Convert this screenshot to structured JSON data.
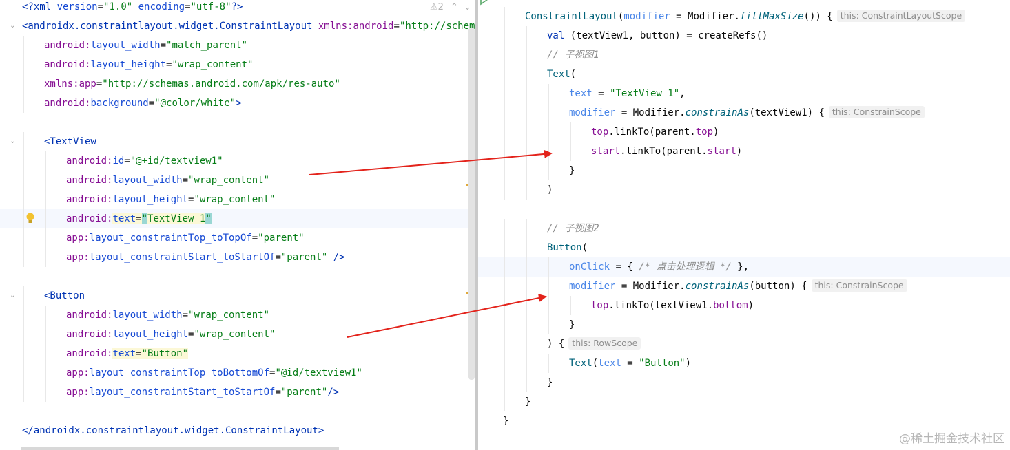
{
  "left": {
    "warning_count": "2",
    "lines": [
      {
        "y": 0,
        "indent": 0,
        "fold": false,
        "tokens": [
          [
            "tk-xml",
            "<?xml "
          ],
          [
            "tk-attr",
            "version"
          ],
          [
            "tk-plain",
            "="
          ],
          [
            "tk-val",
            "\"1.0\""
          ],
          [
            "tk-plain",
            " "
          ],
          [
            "tk-attr",
            "encoding"
          ],
          [
            "tk-plain",
            "="
          ],
          [
            "tk-val",
            "\"utf-8\""
          ],
          [
            "tk-xml",
            "?>"
          ]
        ]
      },
      {
        "indent": 0,
        "fold": true,
        "tokens": [
          [
            "tk-tag",
            "<androidx.constraintlayout.widget.ConstraintLayout "
          ],
          [
            "tk-ns",
            "xmlns:android"
          ],
          [
            "tk-plain",
            "="
          ],
          [
            "tk-val",
            "\"http://schemas.android.com/apk/res/android\""
          ]
        ]
      },
      {
        "indent": 1,
        "tokens": [
          [
            "tk-ns",
            "android:"
          ],
          [
            "tk-attr",
            "layout_width"
          ],
          [
            "tk-plain",
            "="
          ],
          [
            "tk-val",
            "\"match_parent\""
          ]
        ]
      },
      {
        "indent": 1,
        "tokens": [
          [
            "tk-ns",
            "android:"
          ],
          [
            "tk-attr",
            "layout_height"
          ],
          [
            "tk-plain",
            "="
          ],
          [
            "tk-val",
            "\"wrap_content\""
          ]
        ]
      },
      {
        "indent": 1,
        "tokens": [
          [
            "tk-ns",
            "xmlns:app"
          ],
          [
            "tk-plain",
            "="
          ],
          [
            "tk-val",
            "\"http://schemas.android.com/apk/res-auto\""
          ]
        ]
      },
      {
        "indent": 1,
        "tokens": [
          [
            "tk-ns",
            "android:"
          ],
          [
            "tk-attr",
            "background"
          ],
          [
            "tk-plain",
            "="
          ],
          [
            "tk-val",
            "\"@color/white\""
          ],
          [
            "tk-tag",
            ">"
          ]
        ]
      },
      {
        "indent": 0,
        "tokens": []
      },
      {
        "indent": 1,
        "fold": true,
        "tokens": [
          [
            "tk-tag",
            "<TextView"
          ]
        ]
      },
      {
        "indent": 2,
        "tokens": [
          [
            "tk-ns",
            "android:"
          ],
          [
            "tk-attr",
            "id"
          ],
          [
            "tk-plain",
            "="
          ],
          [
            "tk-val",
            "\"@+id/textview1\""
          ]
        ]
      },
      {
        "indent": 2,
        "tokens": [
          [
            "tk-ns",
            "android:"
          ],
          [
            "tk-attr",
            "layout_width"
          ],
          [
            "tk-plain",
            "="
          ],
          [
            "tk-val",
            "\"wrap_content\""
          ]
        ]
      },
      {
        "indent": 2,
        "tokens": [
          [
            "tk-ns",
            "android:"
          ],
          [
            "tk-attr",
            "layout_height"
          ],
          [
            "tk-plain",
            "="
          ],
          [
            "tk-val",
            "\"wrap_content\""
          ]
        ]
      },
      {
        "indent": 2,
        "hl": true,
        "bulb": true,
        "mark": true,
        "tokens": [
          [
            "tk-ns",
            "android:"
          ],
          [
            "tk-attr",
            "text"
          ],
          [
            "tk-plain",
            "="
          ],
          [
            "tk-val cursor-bg",
            "\""
          ],
          [
            "tk-val",
            "TextView 1"
          ],
          [
            "tk-val cursor-bg",
            "\""
          ]
        ]
      },
      {
        "indent": 2,
        "tokens": [
          [
            "tk-ns",
            "app:"
          ],
          [
            "tk-attr",
            "layout_constraintTop_toTopOf"
          ],
          [
            "tk-plain",
            "="
          ],
          [
            "tk-val",
            "\"parent\""
          ]
        ]
      },
      {
        "indent": 2,
        "tokens": [
          [
            "tk-ns",
            "app:"
          ],
          [
            "tk-attr",
            "layout_constraintStart_toStartOf"
          ],
          [
            "tk-plain",
            "="
          ],
          [
            "tk-val",
            "\"parent\""
          ],
          [
            "tk-tag",
            " />"
          ]
        ]
      },
      {
        "indent": 0,
        "tokens": []
      },
      {
        "indent": 1,
        "fold": true,
        "tokens": [
          [
            "tk-tag",
            "<Button"
          ]
        ]
      },
      {
        "indent": 2,
        "tokens": [
          [
            "tk-ns",
            "android:"
          ],
          [
            "tk-attr",
            "layout_width"
          ],
          [
            "tk-plain",
            "="
          ],
          [
            "tk-val",
            "\"wrap_content\""
          ]
        ]
      },
      {
        "indent": 2,
        "tokens": [
          [
            "tk-ns",
            "android:"
          ],
          [
            "tk-attr",
            "layout_height"
          ],
          [
            "tk-plain",
            "="
          ],
          [
            "tk-val",
            "\"wrap_content\""
          ]
        ]
      },
      {
        "indent": 2,
        "mark": true,
        "tokens": [
          [
            "tk-ns",
            "android:"
          ],
          [
            "tk-attr",
            "text"
          ],
          [
            "tk-plain",
            "="
          ],
          [
            "tk-val",
            "\"Button\""
          ]
        ]
      },
      {
        "indent": 2,
        "tokens": [
          [
            "tk-ns",
            "app:"
          ],
          [
            "tk-attr",
            "layout_constraintTop_toBottomOf"
          ],
          [
            "tk-plain",
            "="
          ],
          [
            "tk-val",
            "\"@id/textview1\""
          ]
        ]
      },
      {
        "indent": 2,
        "tokens": [
          [
            "tk-ns",
            "app:"
          ],
          [
            "tk-attr",
            "layout_constraintStart_toStartOf"
          ],
          [
            "tk-plain",
            "="
          ],
          [
            "tk-val",
            "\"parent\""
          ],
          [
            "tk-tag",
            "/>"
          ]
        ]
      },
      {
        "indent": 0,
        "tokens": []
      },
      {
        "indent": 0,
        "tokens": [
          [
            "tk-tag",
            "</androidx.constraintlayout.widget.ConstraintLayout>"
          ]
        ]
      }
    ]
  },
  "right": {
    "lines": [
      {
        "indent": 1,
        "tokens": [
          [
            "tk-fn",
            "ConstraintLayout"
          ],
          [
            "tk-plain",
            "("
          ],
          [
            "tk-param",
            "modifier"
          ],
          [
            "tk-plain",
            " = "
          ],
          [
            "tk-plain",
            "Modifier."
          ],
          [
            "tk-ital",
            "fillMaxSize"
          ],
          [
            "tk-plain",
            "()) {"
          ]
        ],
        "hint": "this: ConstraintLayoutScope"
      },
      {
        "indent": 2,
        "tokens": [
          [
            "tk-kw",
            "val "
          ],
          [
            "tk-plain",
            "(textView1, button) = createRefs()"
          ]
        ]
      },
      {
        "indent": 2,
        "tokens": [
          [
            "tk-comment",
            "// 子视图1"
          ]
        ]
      },
      {
        "indent": 2,
        "tokens": [
          [
            "tk-fn",
            "Text"
          ],
          [
            "tk-plain",
            "("
          ]
        ]
      },
      {
        "indent": 3,
        "tokens": [
          [
            "tk-param",
            "text"
          ],
          [
            "tk-plain",
            " = "
          ],
          [
            "tk-str",
            "\"TextView 1\""
          ],
          [
            "tk-plain",
            ","
          ]
        ]
      },
      {
        "indent": 3,
        "tokens": [
          [
            "tk-param",
            "modifier"
          ],
          [
            "tk-plain",
            " = "
          ],
          [
            "tk-plain",
            "Modifier."
          ],
          [
            "tk-ital",
            "constrainAs"
          ],
          [
            "tk-plain",
            "(textView1) {"
          ]
        ],
        "hint": "this: ConstrainScope"
      },
      {
        "indent": 4,
        "tokens": [
          [
            "tk-prop",
            "top"
          ],
          [
            "tk-plain",
            ".linkTo("
          ],
          [
            "tk-plain",
            "parent."
          ],
          [
            "tk-prop",
            "top"
          ],
          [
            "tk-plain",
            ")"
          ]
        ]
      },
      {
        "indent": 4,
        "tokens": [
          [
            "tk-prop",
            "start"
          ],
          [
            "tk-plain",
            ".linkTo("
          ],
          [
            "tk-plain",
            "parent."
          ],
          [
            "tk-prop",
            "start"
          ],
          [
            "tk-plain",
            ")"
          ]
        ]
      },
      {
        "indent": 3,
        "tokens": [
          [
            "tk-plain",
            "}"
          ]
        ]
      },
      {
        "indent": 2,
        "tokens": [
          [
            "tk-plain",
            ")"
          ]
        ]
      },
      {
        "indent": 0,
        "tokens": []
      },
      {
        "indent": 2,
        "tokens": [
          [
            "tk-comment",
            "// 子视图2"
          ]
        ]
      },
      {
        "indent": 2,
        "tokens": [
          [
            "tk-fn",
            "Button"
          ],
          [
            "tk-plain",
            "("
          ]
        ]
      },
      {
        "indent": 3,
        "hl": true,
        "tokens": [
          [
            "tk-param",
            "onClick"
          ],
          [
            "tk-plain",
            " = { "
          ],
          [
            "tk-comment",
            "/* 点击处理逻辑 */"
          ],
          [
            "tk-plain",
            " },"
          ]
        ]
      },
      {
        "indent": 3,
        "tokens": [
          [
            "tk-param",
            "modifier"
          ],
          [
            "tk-plain",
            " = "
          ],
          [
            "tk-plain",
            "Modifier."
          ],
          [
            "tk-ital",
            "constrainAs"
          ],
          [
            "tk-plain",
            "(button) {"
          ]
        ],
        "hint": "this: ConstrainScope"
      },
      {
        "indent": 4,
        "tokens": [
          [
            "tk-prop",
            "top"
          ],
          [
            "tk-plain",
            ".linkTo(textView1."
          ],
          [
            "tk-prop",
            "bottom"
          ],
          [
            "tk-plain",
            ")"
          ]
        ]
      },
      {
        "indent": 3,
        "tokens": [
          [
            "tk-plain",
            "}"
          ]
        ]
      },
      {
        "indent": 2,
        "tokens": [
          [
            "tk-plain",
            ") {"
          ]
        ],
        "hint": "this: RowScope"
      },
      {
        "indent": 3,
        "tokens": [
          [
            "tk-fn",
            "Text"
          ],
          [
            "tk-plain",
            "("
          ],
          [
            "tk-param",
            "text"
          ],
          [
            "tk-plain",
            " = "
          ],
          [
            "tk-str",
            "\"Button\""
          ],
          [
            "tk-plain",
            ")"
          ]
        ]
      },
      {
        "indent": 2,
        "tokens": [
          [
            "tk-plain",
            "}"
          ]
        ]
      },
      {
        "indent": 1,
        "tokens": [
          [
            "tk-plain",
            "}"
          ]
        ]
      },
      {
        "indent": 0,
        "tokens": [
          [
            "tk-plain",
            "}"
          ]
        ]
      }
    ]
  },
  "watermark": "@稀土掘金技术社区",
  "colors": {
    "arrow": "#e3231b",
    "highlight_line": "#f5f8fe"
  }
}
